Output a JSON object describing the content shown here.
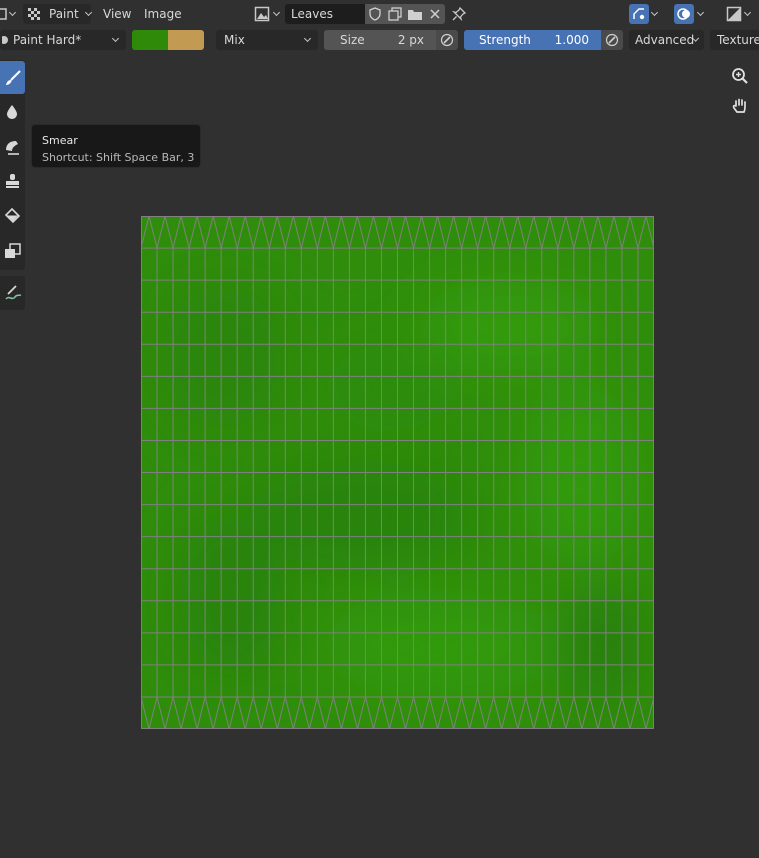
{
  "header": {
    "mode_label": "Paint",
    "menu_view": "View",
    "menu_image": "Image",
    "image_name": "Leaves"
  },
  "tool_settings": {
    "brush_name": "Paint Hard*",
    "primary_color": "#2f8a09",
    "secondary_color": "#c29a52",
    "blend_mode": "Mix",
    "size_label": "Size",
    "size_value": "2 px",
    "strength_label": "Strength",
    "strength_value": "1.000",
    "strength_fraction": 1.0,
    "advanced_label": "Advanced",
    "texture_label": "Texture"
  },
  "tools": [
    {
      "name": "draw-tool",
      "icon": "brush-icon",
      "active": true
    },
    {
      "name": "soften-tool",
      "icon": "drop-icon",
      "active": false
    },
    {
      "name": "smear-tool",
      "icon": "smear-icon",
      "active": false
    },
    {
      "name": "clone-tool",
      "icon": "stamp-icon",
      "active": false
    },
    {
      "name": "fill-tool",
      "icon": "bucket-icon",
      "active": false
    },
    {
      "name": "mask-tool",
      "icon": "mask-icon",
      "active": false
    },
    {
      "name": "annotate-tool",
      "icon": "annotate-icon",
      "active": false
    }
  ],
  "tooltip": {
    "title": "Smear",
    "shortcut": "Shortcut: Shift Space Bar, 3"
  },
  "colors": {
    "accent_blue": "#4772b3",
    "canvas_green": "#2f8d0b",
    "uv_wire": "#808080"
  }
}
